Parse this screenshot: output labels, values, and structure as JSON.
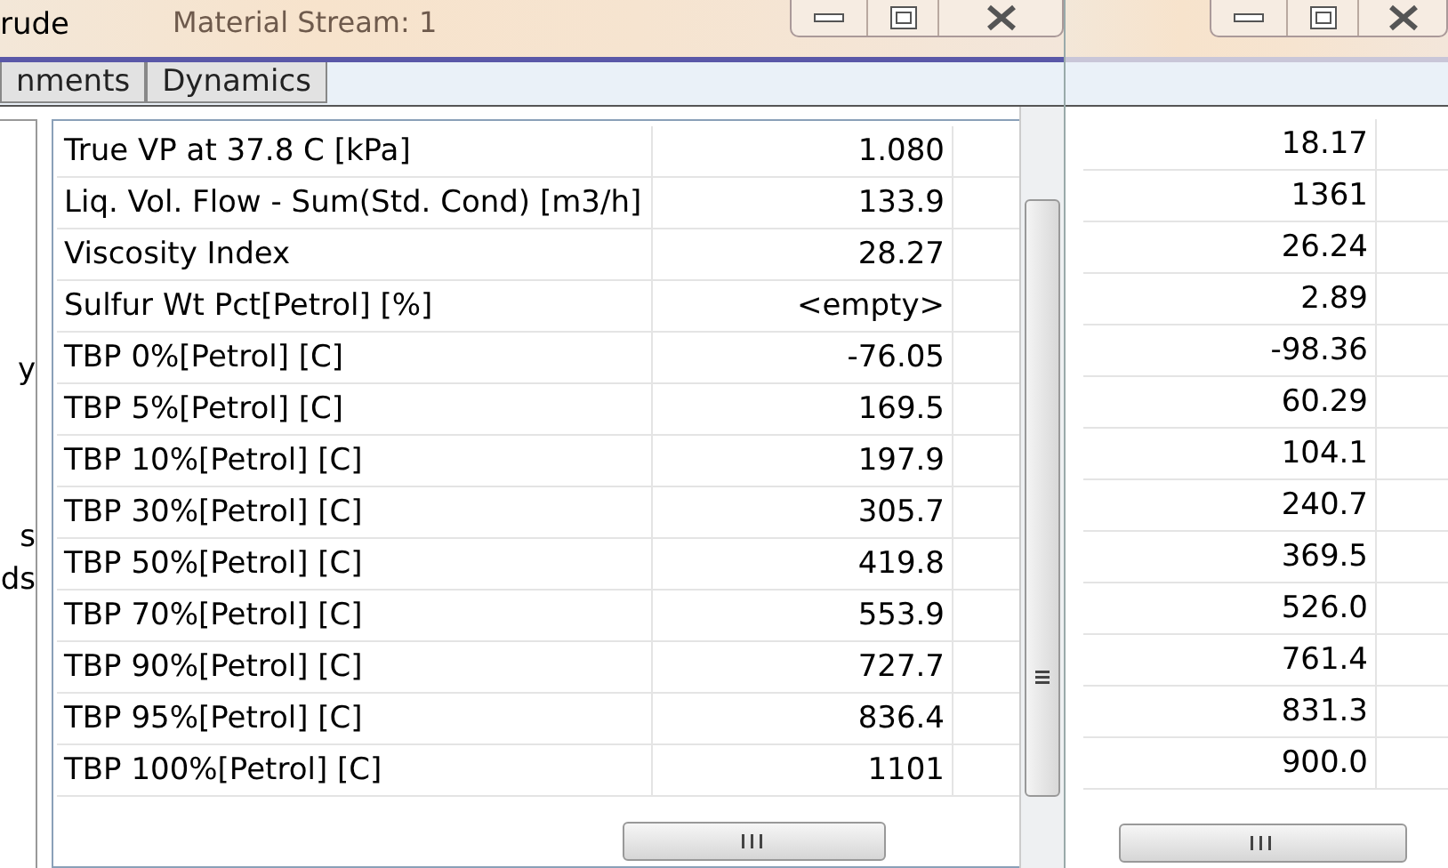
{
  "left_window": {
    "title": "rude",
    "background_title": "Material Stream: 1",
    "tabs": [
      {
        "label": "nments",
        "selected": false
      },
      {
        "label": "Dynamics",
        "selected": false
      }
    ],
    "side_fragments": [
      "y",
      "s",
      "ds"
    ],
    "rows": [
      {
        "label": "True VP at 37.8 C [kPa]",
        "value": "1.080"
      },
      {
        "label": "Liq. Vol. Flow - Sum(Std. Cond) [m3/h]",
        "value": "133.9"
      },
      {
        "label": "Viscosity Index",
        "value": "28.27"
      },
      {
        "label": "Sulfur Wt Pct[Petrol] [%]",
        "value": "<empty>"
      },
      {
        "label": "TBP 0%[Petrol] [C]",
        "value": "-76.05"
      },
      {
        "label": "TBP 5%[Petrol] [C]",
        "value": "169.5"
      },
      {
        "label": "TBP 10%[Petrol] [C]",
        "value": "197.9"
      },
      {
        "label": "TBP 30%[Petrol] [C]",
        "value": "305.7"
      },
      {
        "label": "TBP 50%[Petrol] [C]",
        "value": "419.8"
      },
      {
        "label": "TBP 70%[Petrol] [C]",
        "value": "553.9"
      },
      {
        "label": "TBP 90%[Petrol] [C]",
        "value": "727.7"
      },
      {
        "label": "TBP 95%[Petrol] [C]",
        "value": "836.4"
      },
      {
        "label": "TBP 100%[Petrol] [C]",
        "value": "1101"
      }
    ]
  },
  "right_window": {
    "values": [
      "18.17",
      "1361",
      "26.24",
      "2.89",
      "-98.36",
      "60.29",
      "104.1",
      "240.7",
      "369.5",
      "526.0",
      "761.4",
      "831.3",
      "900.0"
    ]
  }
}
